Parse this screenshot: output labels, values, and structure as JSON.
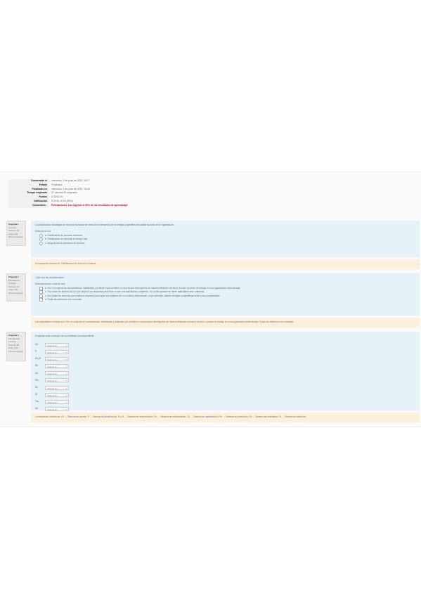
{
  "summary": {
    "rows": [
      {
        "label": "Comenzado el",
        "value": "miércoles, 3 de junio de 2020, 18:17"
      },
      {
        "label": "Estado",
        "value": "Finalizado"
      },
      {
        "label": "Finalizado en",
        "value": "miércoles, 3 de junio de 2020, 18:45"
      },
      {
        "label": "Tiempo empleado",
        "value": "27 minutos 52 segundos"
      },
      {
        "label": "Puntos",
        "value": "8,33/10,00"
      },
      {
        "label": "Calificación",
        "value": "8,33 de 10,00 (83%)"
      },
      {
        "label": "Comentario -",
        "value": "Felicitaciones, has logrado el 80% de los resultados de aprendizaje"
      }
    ]
  },
  "questions": [
    {
      "info": {
        "number": "Pregunta 1",
        "state": "Correcta",
        "points": "Puntúa 1,00 sobre 1,00",
        "flag": "Marcar pregunta"
      },
      "text": "La planificación estratégica de recursos humanos se centra en el desarrollo de la ventaja competitiva del capital humano de la organización.",
      "prompt": "Seleccione una:",
      "options": [
        "a. Planificación de recursos humanos",
        "b. Planificación de personal en tiempo real",
        "c. Ninguna de las anteriores es correcta"
      ],
      "feedback": "La respuesta correcta es: Planificación de recursos humanos"
    },
    {
      "info": {
        "number": "Pregunta 2",
        "state": "Parcialmente correcta",
        "points": "Puntúa 0,33 sobre 1,00",
        "flag": "Marcar pregunta"
      },
      "text": "¿Qué son las competencias?",
      "prompt": "Seleccione una o más de una:",
      "options": [
        "a. Son un conjunto de conocimientos, habilidades y actitudes que permiten a una persona desempeñar de manera eficiente una tarea, función o puesto de trabajo en una organización determinada.",
        "b. Son todos los factores de los que dispone una empresa para llevar a cabo sus actividades y objetivos, los cuales pueden ser tanto materiales como humanos.",
        "c. Son todas las acciones que realiza la empresa para lograr sus objetivos en un contexto determinado, y que permiten obtener ventajas competitivas frente a sus competidores.",
        "d. Todas las anteriores son correctas"
      ],
      "feedback": "Las respuestas correctas son: Son un conjunto de conocimientos, habilidades y actitudes que permiten a una persona desempeñar de manera eficiente una tarea, función o puesto de trabajo en una organización determinada, Todas las anteriores son correctas"
    },
    {
      "info": {
        "number": "Pregunta 3",
        "state": "Parcialmente correcta",
        "points": "Puntúa 0,89 sobre 1,00",
        "flag": "Marcar pregunta"
      },
      "text": "Empareje cada concepto con su definición correspondiente",
      "matches": [
        {
          "key": "Ch",
          "value": "Sistema de..."
        },
        {
          "key": "P",
          "value": "Sistema de..."
        },
        {
          "key": "M y R",
          "value": "Sistema de..."
        },
        {
          "key": "Re",
          "value": "Sistema de..."
        },
        {
          "key": "Cd",
          "value": "Sistema de..."
        },
        {
          "key": "Pm",
          "value": "Sistema de..."
        },
        {
          "key": "Ev",
          "value": "Sistema de..."
        },
        {
          "key": "St",
          "value": "Sistema de..."
        },
        {
          "key": "Tra",
          "value": "Sistema de..."
        },
        {
          "key": "Dd",
          "value": "Sistema de..."
        }
      ],
      "feedback": "La respuesta correcta es: Ch → Sistema de cambio, P → Sistema de planificación, M y R → Sistema de remuneración, Re → Sistema de reclutamiento, Cd → Sistema de capacitación, Pm → Sistema de promoción, Ev → Sistema de evaluación, St → Sistema de selección"
    }
  ],
  "colors": {
    "qbg": "#e5f3f8",
    "feedback_bg": "#fcefdc",
    "comment_red": "#d0021b"
  }
}
